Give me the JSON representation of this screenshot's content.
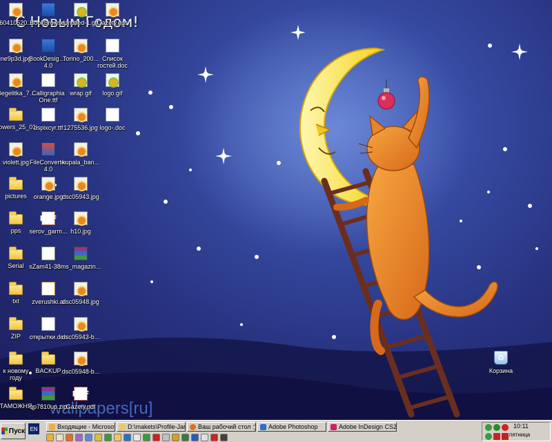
{
  "desktop": {
    "greeting": "С Новым Годом!",
    "watermark": "wallpapers[ru]",
    "icons": [
      {
        "label": "60410520...",
        "type": "jpg"
      },
      {
        "label": "BookBrowser",
        "type": "app"
      },
      {
        "label": "Untitled-1.gif",
        "type": "gif"
      },
      {
        "label": "Gazety.eps",
        "type": "jpg"
      },
      {
        "label": "ne9p3d.jpg",
        "type": "jpg"
      },
      {
        "label": "BookDesigner 4.0",
        "type": "app"
      },
      {
        "label": "Torino_200...",
        "type": "jpg"
      },
      {
        "label": "Список гостей.doc",
        "type": "doc"
      },
      {
        "label": "Begelitka_7...",
        "type": "jpg"
      },
      {
        "label": "Calligraphia One.ttf",
        "type": "ttf"
      },
      {
        "label": "wrap.gif",
        "type": "gif"
      },
      {
        "label": "logo.gif",
        "type": "gif"
      },
      {
        "label": "flowers_25_01",
        "type": "folder"
      },
      {
        "label": "dspixcyr.ttf",
        "type": "ttf"
      },
      {
        "label": "1275536.jpg",
        "type": "jpg"
      },
      {
        "label": "logo-.doc",
        "type": "doc"
      },
      {
        "label": "violett.jpg",
        "type": "jpg"
      },
      {
        "label": "FileConvertor 4.0",
        "type": "app2"
      },
      {
        "label": "kupala_ban...",
        "type": "jpg"
      },
      {
        "label": "pictures",
        "type": "folder"
      },
      {
        "label": "orange.jpg",
        "type": "jpg"
      },
      {
        "label": "dsc05943.jpg",
        "type": "jpg"
      },
      {
        "label": "pps",
        "type": "folder"
      },
      {
        "label": "serov_garm...",
        "type": "pdf"
      },
      {
        "label": "h10.jpg",
        "type": "jpg"
      },
      {
        "label": "Serial",
        "type": "folder"
      },
      {
        "label": "sZam41-38....",
        "type": "cert"
      },
      {
        "label": "ms_magazin...",
        "type": "zip"
      },
      {
        "label": "txt",
        "type": "folder"
      },
      {
        "label": "zverushki.ai",
        "type": "ai"
      },
      {
        "label": "dsc05948.jpg",
        "type": "jpg"
      },
      {
        "label": "ZIP",
        "type": "folder"
      },
      {
        "label": "открытки.doc",
        "type": "doc"
      },
      {
        "label": "dsc05943-b...",
        "type": "jpg"
      },
      {
        "label": "к новому году",
        "type": "folder"
      },
      {
        "label": "BACKUP",
        "type": "folder"
      },
      {
        "label": "dsc05948-b...",
        "type": "jpg"
      },
      {
        "label": "ТАМОЖНЯ",
        "type": "folder"
      },
      {
        "label": "qp7810up.zip",
        "type": "zip"
      },
      {
        "label": "Gazety.pdf",
        "type": "pdf"
      },
      {
        "label": "Корзина",
        "type": "bin"
      }
    ]
  },
  "taskbar": {
    "start_label": "Пуск",
    "language": "EN",
    "tasks": [
      {
        "label": "Входящие - Microsoft O...",
        "color": "#f0b030"
      },
      {
        "label": "D:\\makets\\Profile-Januar...",
        "color": "#f0c860"
      },
      {
        "label": "Ваш рабочий стол :) - Ф...",
        "color": "#e07020"
      },
      {
        "label": "Adobe Photoshop",
        "color": "#2a70c8"
      },
      {
        "label": "Adobe InDesign CS2",
        "color": "#d02060"
      }
    ],
    "clock": "10:11",
    "day": "пятница"
  }
}
